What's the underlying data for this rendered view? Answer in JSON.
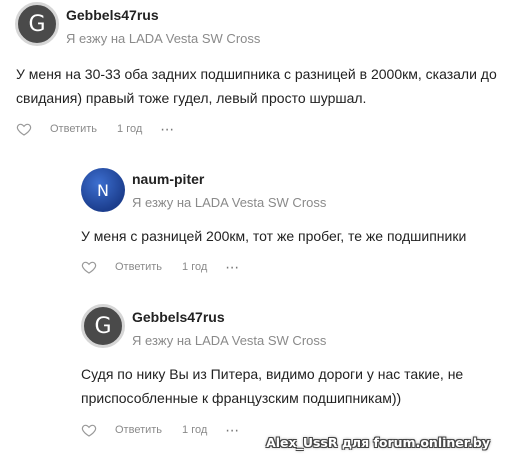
{
  "comments": [
    {
      "avatar_letter": "G",
      "author": "Gebbels47rus",
      "car": "Я езжу на LADA Vesta SW Cross",
      "text": "У меня на 30-33 оба задних подшипника с разницей в 2000км, сказали до свидания) правый тоже гудел, левый просто шуршал.",
      "reply_label": "Ответить",
      "time": "1 год",
      "more": "⋯"
    },
    {
      "avatar_letter": "N",
      "author": "naum-piter",
      "car": "Я езжу на LADA Vesta SW Cross",
      "text": "У меня с разницей 200км, тот же пробег, те же подшипники",
      "reply_label": "Ответить",
      "time": "1 год",
      "more": "⋯"
    },
    {
      "avatar_letter": "G",
      "author": "Gebbels47rus",
      "car": "Я езжу на LADA Vesta SW Cross",
      "text": "Судя по нику Вы из Питера, видимо дороги у нас такие, не приспособленные к французским подшипникам))",
      "reply_label": "Ответить",
      "time": "1 год",
      "more": "⋯"
    }
  ],
  "watermark": "Alex_UssR для forum.onliner.by",
  "icons": {
    "like": "heart-icon",
    "more": "more-icon"
  }
}
